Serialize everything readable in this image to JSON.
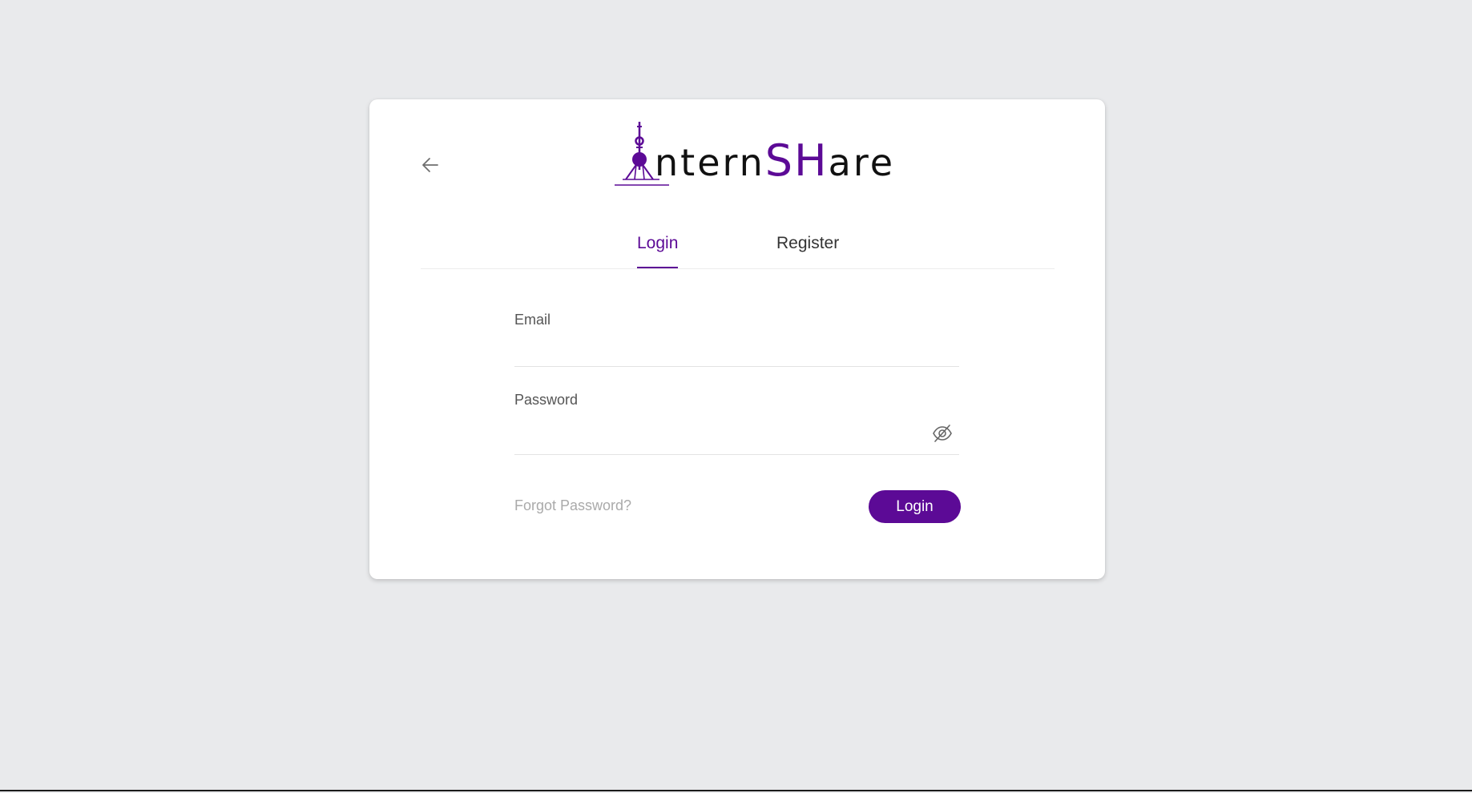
{
  "brand": {
    "logo_text_pre": "ntern",
    "logo_text_accent": "SH",
    "logo_text_post": "are",
    "accent_color": "#5c0a96"
  },
  "nav": {
    "back_icon": "arrow-left-icon"
  },
  "tabs": [
    {
      "label": "Login",
      "active": true
    },
    {
      "label": "Register",
      "active": false
    }
  ],
  "form": {
    "email_label": "Email",
    "email_value": "",
    "password_label": "Password",
    "password_value": "",
    "password_toggle_icon": "eye-slash-icon",
    "forgot_label": "Forgot Password?",
    "submit_label": "Login"
  }
}
